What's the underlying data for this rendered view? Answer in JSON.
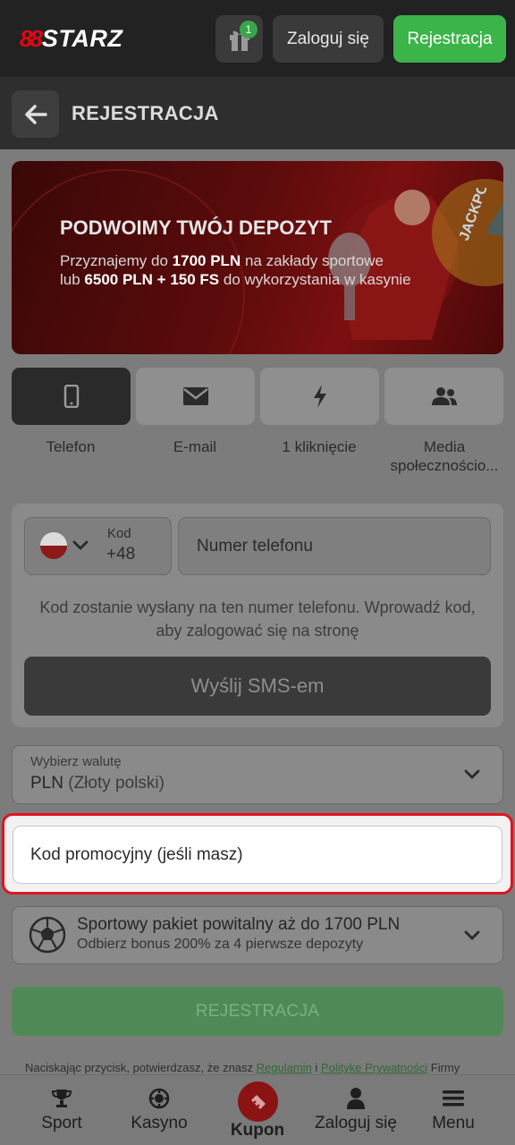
{
  "header": {
    "logo_mark": "88",
    "logo_text": "STARZ",
    "gift_badge": "1",
    "login_label": "Zaloguj się",
    "register_label": "Rejestracja"
  },
  "page": {
    "title": "REJESTRACJA"
  },
  "banner": {
    "title": "PODWOIMY TWÓJ DEPOZYT",
    "line1_pre": "Przyznajemy do ",
    "line1_bold": "1700 PLN",
    "line1_post": " na zakłady sportowe",
    "line2_pre": "lub ",
    "line2_bold": "6500 PLN + 150 FS",
    "line2_post": " do wykorzystania w kasynie",
    "wheel_text": "JACKPOT"
  },
  "tabs": [
    {
      "label": "Telefon",
      "icon": "phone-icon",
      "active": true
    },
    {
      "label": "E-mail",
      "icon": "envelope-icon",
      "active": false
    },
    {
      "label": "1 kliknięcie",
      "icon": "lightning-icon",
      "active": false
    },
    {
      "label": "Media społecznościo...",
      "icon": "users-icon",
      "active": false
    }
  ],
  "phone": {
    "code_label": "Kod",
    "code_value": "+48",
    "placeholder": "Numer telefonu",
    "info": "Kod zostanie wysłany na ten numer telefonu. Wprowadź kod, aby zalogować się na stronę",
    "sms_button": "Wyślij SMS-em"
  },
  "currency": {
    "label": "Wybierz walutę",
    "code": "PLN",
    "name": "(Złoty polski)"
  },
  "promo": {
    "placeholder": "Kod promocyjny (jeśli masz)"
  },
  "bonus": {
    "title": "Sportowy pakiet powitalny aż do 1700 PLN",
    "subtitle": "Odbierz bonus 200% za 4 pierwsze depozyty"
  },
  "register_button": "REJESTRACJA",
  "terms": {
    "pre": "Naciskając przycisk, potwierdzasz, że znasz ",
    "link1": "Regulamin",
    "mid": " i ",
    "link2": "Polityke Prywatności",
    "post": " Firmy"
  },
  "bottom_nav": {
    "sport": "Sport",
    "casino": "Kasyno",
    "kupon": "Kupon",
    "login": "Zaloguj się",
    "menu": "Menu"
  },
  "colors": {
    "accent_green": "#3bb54a",
    "highlight_red": "#e1141e",
    "brand_red": "#e30613"
  }
}
